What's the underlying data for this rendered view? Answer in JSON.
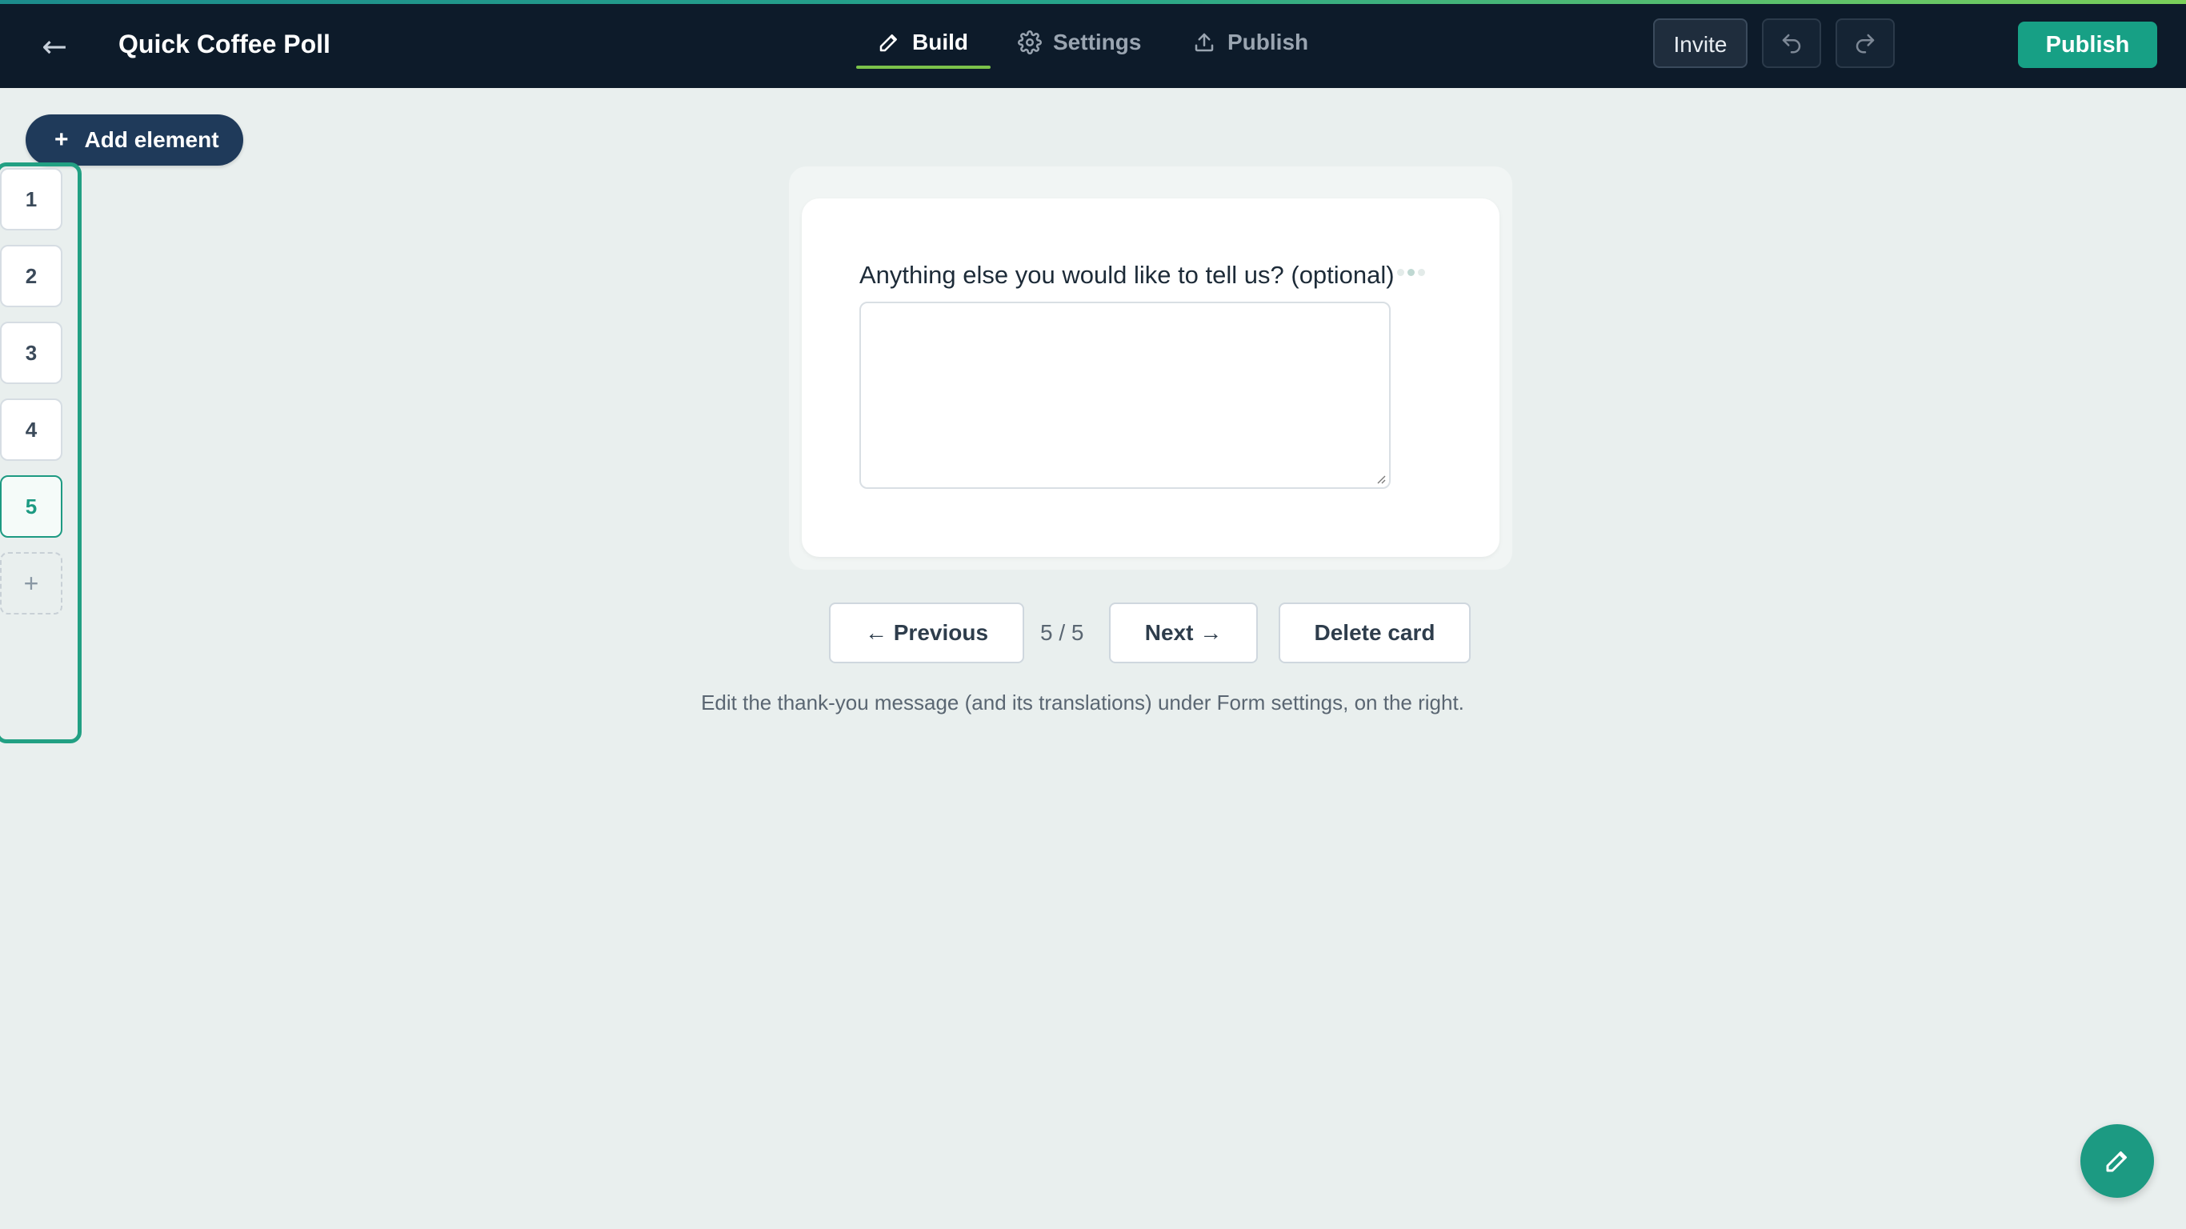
{
  "header": {
    "title": "Quick Coffee Poll",
    "tabs": [
      {
        "label": "Build",
        "active": true
      },
      {
        "label": "Settings",
        "active": false
      },
      {
        "label": "Publish",
        "active": false
      }
    ],
    "invite_label": "Invite",
    "publish_label": "Publish",
    "accent_color": "#17a085",
    "background_color": "#0d1b2a"
  },
  "toolbar": {
    "add_element_label": "Add element"
  },
  "steps": {
    "items": [
      "1",
      "2",
      "3",
      "4",
      "5"
    ],
    "active": "5",
    "add_symbol": "+"
  },
  "card": {
    "question": "Anything else you would like to tell us? (optional)",
    "answer_value": ""
  },
  "navigation": {
    "previous_label": "← Previous",
    "counter": "5 / 5",
    "next_label": "Next →",
    "delete_label": "Delete card"
  },
  "hint": "Edit the thank-you message (and its translations) under Form settings, on the right."
}
